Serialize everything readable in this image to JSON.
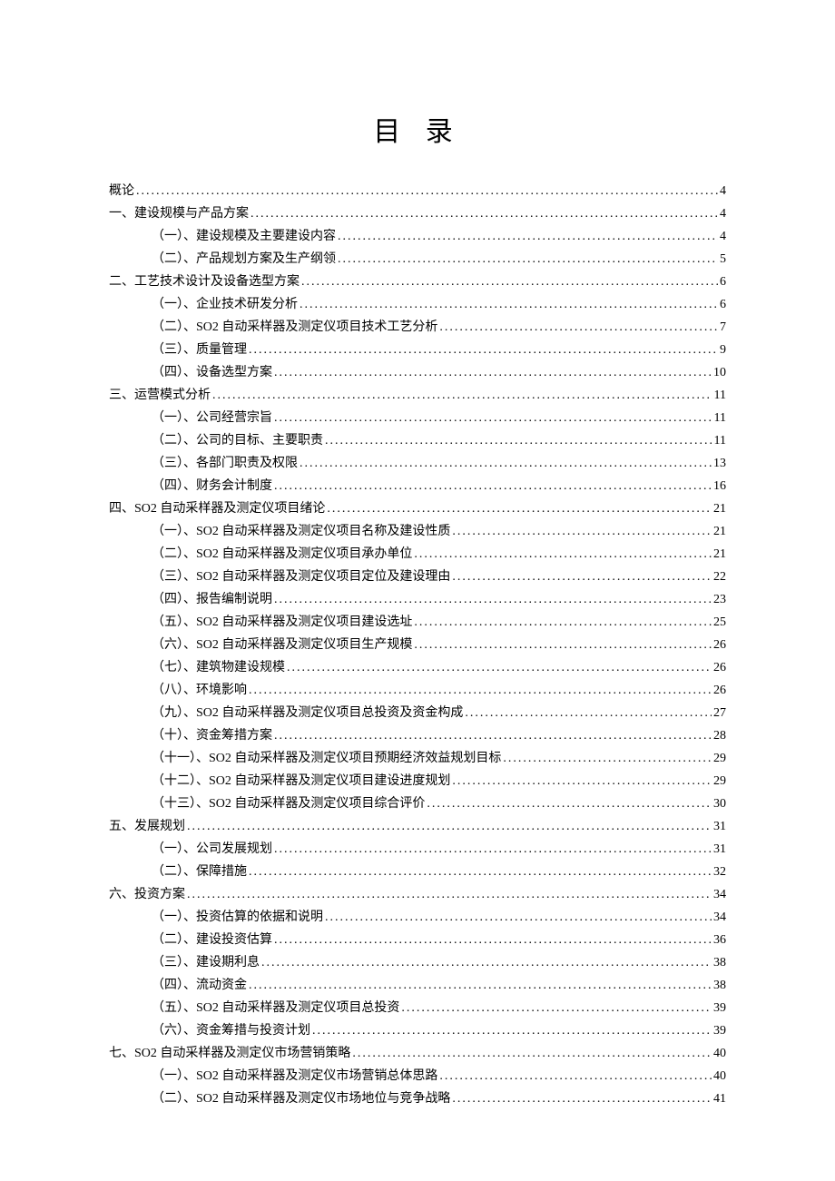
{
  "title": "目 录",
  "toc": [
    {
      "level": 0,
      "label": "概论",
      "page": "4"
    },
    {
      "level": 0,
      "label": "一、建设规模与产品方案",
      "page": "4"
    },
    {
      "level": 1,
      "label": "（一）、建设规模及主要建设内容",
      "page": "4"
    },
    {
      "level": 1,
      "label": "（二）、产品规划方案及生产纲领",
      "page": "5"
    },
    {
      "level": 0,
      "label": "二、工艺技术设计及设备选型方案",
      "page": "6"
    },
    {
      "level": 1,
      "label": "（一）、企业技术研发分析",
      "page": "6"
    },
    {
      "level": 1,
      "label": "（二）、SO2 自动采样器及测定仪项目技术工艺分析",
      "page": "7"
    },
    {
      "level": 1,
      "label": "（三）、质量管理",
      "page": "9"
    },
    {
      "level": 1,
      "label": "（四）、设备选型方案",
      "page": "10"
    },
    {
      "level": 0,
      "label": "三、运营模式分析",
      "page": "11"
    },
    {
      "level": 1,
      "label": "（一）、公司经营宗旨",
      "page": "11"
    },
    {
      "level": 1,
      "label": "（二）、公司的目标、主要职责",
      "page": "11"
    },
    {
      "level": 1,
      "label": "（三）、各部门职责及权限",
      "page": "13"
    },
    {
      "level": 1,
      "label": "（四）、财务会计制度",
      "page": "16"
    },
    {
      "level": 0,
      "label": "四、SO2 自动采样器及测定仪项目绪论",
      "page": "21"
    },
    {
      "level": 1,
      "label": "（一）、SO2 自动采样器及测定仪项目名称及建设性质",
      "page": "21"
    },
    {
      "level": 1,
      "label": "（二）、SO2 自动采样器及测定仪项目承办单位",
      "page": "21"
    },
    {
      "level": 1,
      "label": "（三）、SO2 自动采样器及测定仪项目定位及建设理由",
      "page": "22"
    },
    {
      "level": 1,
      "label": "（四）、报告编制说明",
      "page": "23"
    },
    {
      "level": 1,
      "label": "（五）、SO2 自动采样器及测定仪项目建设选址",
      "page": "25"
    },
    {
      "level": 1,
      "label": "（六）、SO2 自动采样器及测定仪项目生产规模",
      "page": "26"
    },
    {
      "level": 1,
      "label": "（七）、建筑物建设规模",
      "page": "26"
    },
    {
      "level": 1,
      "label": "（八）、环境影响",
      "page": "26"
    },
    {
      "level": 1,
      "label": "（九）、SO2 自动采样器及测定仪项目总投资及资金构成",
      "page": "27"
    },
    {
      "level": 1,
      "label": "（十）、资金筹措方案",
      "page": "28"
    },
    {
      "level": 1,
      "label": "（十一）、SO2 自动采样器及测定仪项目预期经济效益规划目标",
      "page": "29"
    },
    {
      "level": 1,
      "label": "（十二）、SO2 自动采样器及测定仪项目建设进度规划",
      "page": "29"
    },
    {
      "level": 1,
      "label": "（十三）、SO2 自动采样器及测定仪项目综合评价",
      "page": "30"
    },
    {
      "level": 0,
      "label": "五、发展规划",
      "page": "31"
    },
    {
      "level": 1,
      "label": "（一）、公司发展规划",
      "page": "31"
    },
    {
      "level": 1,
      "label": "（二）、保障措施",
      "page": "32"
    },
    {
      "level": 0,
      "label": "六、投资方案",
      "page": "34"
    },
    {
      "level": 1,
      "label": "（一）、投资估算的依据和说明",
      "page": "34"
    },
    {
      "level": 1,
      "label": "（二）、建设投资估算",
      "page": "36"
    },
    {
      "level": 1,
      "label": "（三）、建设期利息",
      "page": "38"
    },
    {
      "level": 1,
      "label": "（四）、流动资金",
      "page": "38"
    },
    {
      "level": 1,
      "label": "（五）、SO2 自动采样器及测定仪项目总投资",
      "page": "39"
    },
    {
      "level": 1,
      "label": "（六）、资金筹措与投资计划",
      "page": "39"
    },
    {
      "level": 0,
      "label": "七、SO2 自动采样器及测定仪市场营销策略",
      "page": "40"
    },
    {
      "level": 1,
      "label": "（一）、SO2 自动采样器及测定仪市场营销总体思路",
      "page": "40"
    },
    {
      "level": 1,
      "label": "（二）、SO2 自动采样器及测定仪市场地位与竞争战略",
      "page": "41"
    }
  ]
}
